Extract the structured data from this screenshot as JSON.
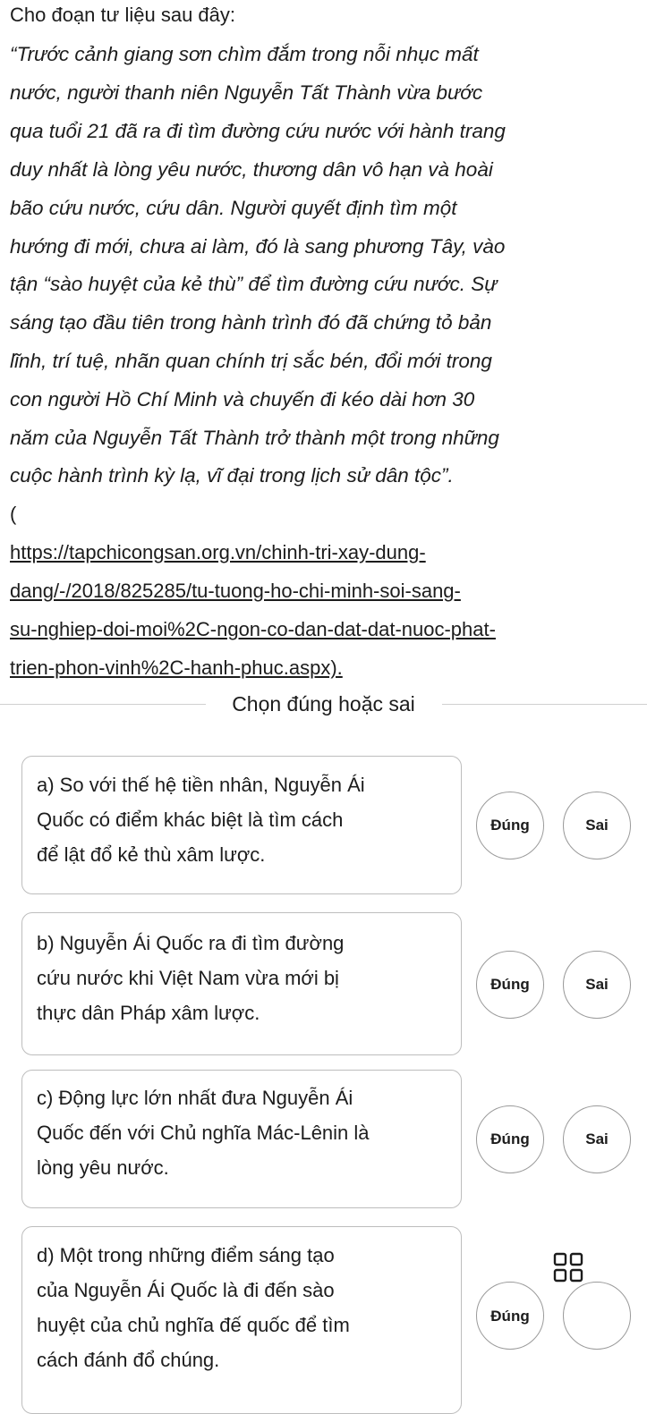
{
  "passage": {
    "intro": "Cho đoạn tư liệu sau đây:",
    "quote_lines": [
      "“Trước cảnh giang sơn chìm đắm trong nỗi nhục mất",
      "nước, người thanh niên Nguyễn Tất Thành vừa bước",
      "qua tuổi 21 đã ra đi tìm đường cứu nước với hành trang",
      "duy nhất là lòng yêu nước, thương dân vô hạn và hoài",
      "bão cứu nước, cứu dân. Người quyết định tìm một",
      "hướng đi mới, chưa ai làm, đó là sang phương Tây, vào",
      "tận “sào huyệt của kẻ thù” để tìm đường cứu nước. Sự",
      "sáng tạo đầu tiên trong hành trình đó đã chứng tỏ bản",
      "lĩnh, trí tuệ, nhãn quan chính trị sắc bén, đổi mới trong",
      "con người Hồ Chí Minh và chuyến đi kéo dài hơn 30",
      "năm của Nguyễn Tất Thành trở thành một trong những",
      "cuộc hành trình kỳ lạ, vĩ đại trong lịch sử dân tộc”."
    ],
    "open_paren": "(",
    "link_lines": [
      "https://tapchicongsan.org.vn/chinh-tri-xay-dung-",
      "dang/-/2018/825285/tu-tuong-ho-chi-minh-soi-sang-",
      "su-nghiep-doi-moi%2C-ngon-co-dan-dat-dat-nuoc-phat-",
      "trien-phon-vinh%2C-hanh-phuc.aspx)."
    ]
  },
  "section_title": "Chọn đúng hoặc sai",
  "questions": [
    {
      "lines": [
        "a) So với thế hệ tiền nhân, Nguyễn Ái",
        "Quốc có điểm khác biệt là tìm cách",
        "để lật đổ kẻ thù xâm lược."
      ],
      "true_label": "Đúng",
      "false_label": "Sai"
    },
    {
      "lines": [
        "b) Nguyễn Ái Quốc ra đi tìm đường",
        "cứu nước khi Việt Nam vừa mới bị",
        "thực dân Pháp xâm lược."
      ],
      "true_label": "Đúng",
      "false_label": "Sai"
    },
    {
      "lines": [
        "c) Động lực lớn nhất đưa Nguyễn Ái",
        "Quốc đến với Chủ nghĩa Mác-Lênin là",
        "lòng yêu nước."
      ],
      "true_label": "Đúng",
      "false_label": "Sai"
    },
    {
      "lines": [
        "d) Một trong những điểm sáng tạo",
        "của Nguyễn Ái Quốc là đi đến sào",
        "huyệt của chủ nghĩa đế quốc để tìm",
        "cách đánh đổ chúng."
      ],
      "true_label": "Đúng",
      "false_label": ""
    }
  ],
  "icons": {
    "menu_grid": "grid-icon"
  }
}
